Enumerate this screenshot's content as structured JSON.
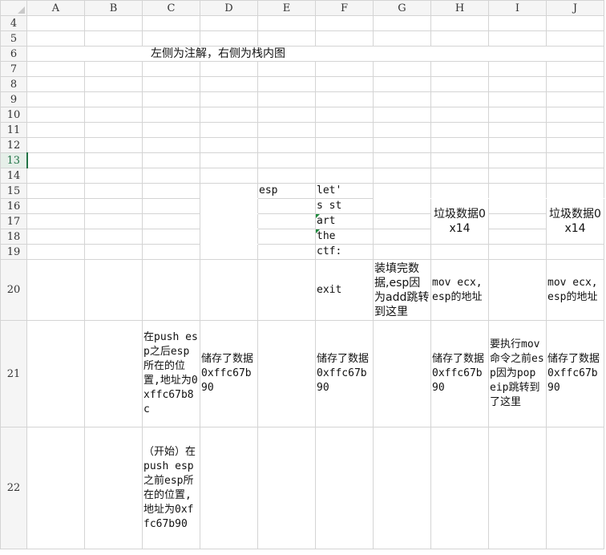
{
  "columns": [
    "A",
    "B",
    "C",
    "D",
    "E",
    "F",
    "G",
    "H",
    "I",
    "J"
  ],
  "rows": [
    "4",
    "5",
    "6",
    "7",
    "8",
    "9",
    "10",
    "11",
    "12",
    "13",
    "14",
    "15",
    "16",
    "17",
    "18",
    "19",
    "20",
    "21",
    "22"
  ],
  "selected_row": "13",
  "cells": {
    "C6": "左侧为注解，右侧为栈内图",
    "E15": "esp",
    "F15": "let'",
    "F16": "s st",
    "F17": "art",
    "F18": "the",
    "F19": "ctf:",
    "F20": "exit",
    "G20": "装填完数据,esp因为add跳转到这里",
    "H16": "垃圾数据0x14",
    "J16": "垃圾数据0x14",
    "H20": "mov ecx,esp的地址",
    "J20": "mov ecx,esp的地址",
    "C21": "在push esp之后esp所在的位置,地址为0xffc67b8c",
    "D21": "储存了数据0xffc67b90",
    "F21": "储存了数据0xffc67b90",
    "H21": "储存了数据0xffc67b90",
    "I21": "要执行mov命令之前esp因为pop eip跳转到了这里",
    "J21": "储存了数据0xffc67b90",
    "C22": "（开始）在push esp之前esp所在的位置,地址为0xffc67b90"
  },
  "colors": {
    "grid": "#d4d4d4",
    "header_bg": "#f5f5f5",
    "selected": "#217346",
    "comment_marker": "#1e8a3c"
  }
}
